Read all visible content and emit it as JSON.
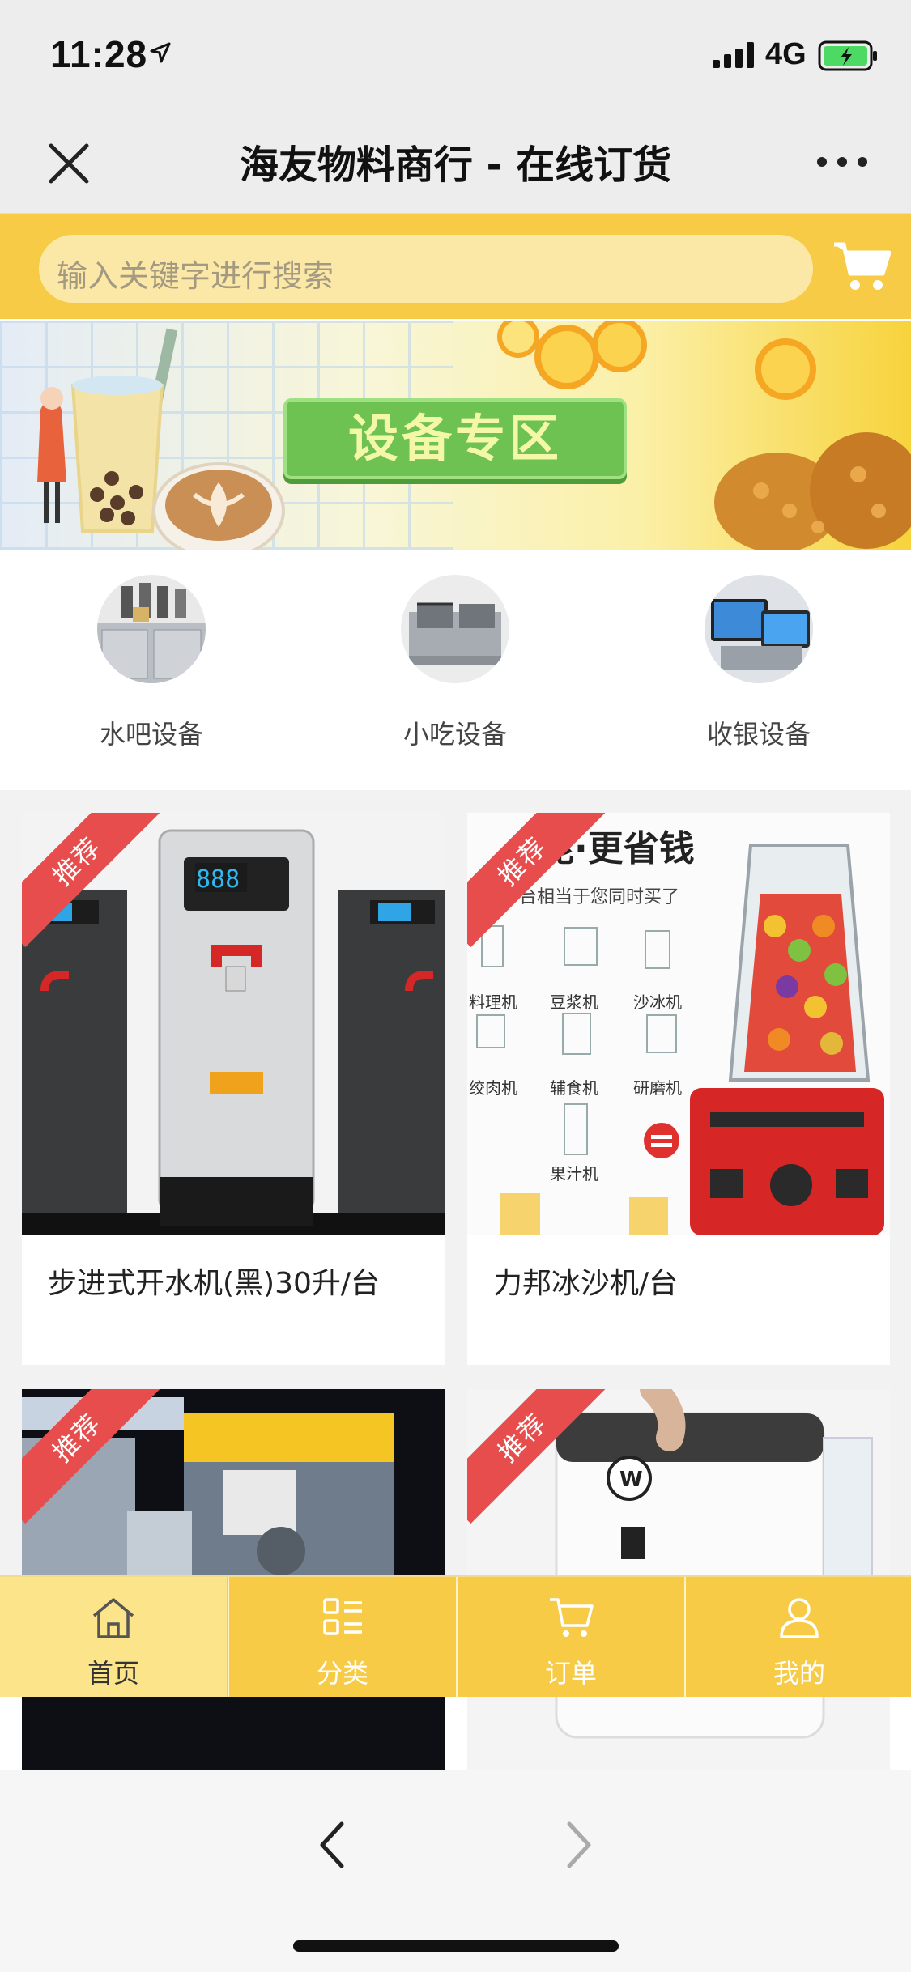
{
  "status_bar": {
    "time": "11:28",
    "network": "4G"
  },
  "nav": {
    "title": "海友物料商行 - 在线订货"
  },
  "search": {
    "placeholder": "输入关键字进行搜索"
  },
  "banner": {
    "label": "设备专区"
  },
  "categories": [
    {
      "label": "水吧设备"
    },
    {
      "label": "小吃设备"
    },
    {
      "label": "收银设备"
    }
  ],
  "products": [
    {
      "name": "步进式开水机(黑)30升/台",
      "badge": "推荐",
      "display": "888"
    },
    {
      "name": "力邦冰沙机/台",
      "badge": "推荐",
      "headline": "能·更省钱",
      "subline": "一台相当于您同时买了",
      "features": [
        "料理机",
        "豆浆机",
        "沙冰机",
        "绞肉机",
        "辅食机",
        "研磨机",
        "果汁机"
      ]
    },
    {
      "name": "",
      "badge": "推荐"
    },
    {
      "name": "",
      "badge": "推荐"
    }
  ],
  "tabs": [
    {
      "label": "首页",
      "icon": "home-icon",
      "active": true
    },
    {
      "label": "分类",
      "icon": "category-icon",
      "active": false
    },
    {
      "label": "订单",
      "icon": "cart-icon",
      "active": false
    },
    {
      "label": "我的",
      "icon": "user-icon",
      "active": false
    }
  ],
  "colors": {
    "accent": "#f7cb46",
    "badge": "#e84d4d",
    "tab_active": "#fbe48a"
  }
}
